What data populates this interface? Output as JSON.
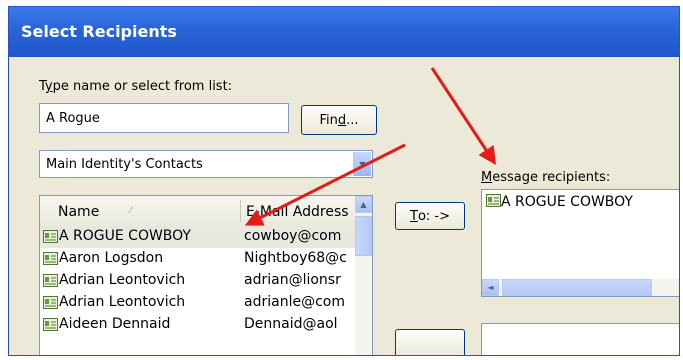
{
  "window": {
    "title": "Select Recipients"
  },
  "search": {
    "label_prefix": "T",
    "label_underlined": "y",
    "label_suffix": "pe name or select from list:",
    "value": "A Rogue"
  },
  "find_button": {
    "label_prefix": "Fin",
    "label_underlined": "d",
    "label_suffix": "..."
  },
  "address_book": {
    "selected": "Main Identity's Contacts"
  },
  "contacts": {
    "headers": {
      "name": "Name",
      "email": "E-Mail Address"
    },
    "rows": [
      {
        "name": "A ROGUE COWBOY",
        "email": "cowboy@com",
        "selected": true
      },
      {
        "name": "Aaron Logsdon",
        "email": "Nightboy68@c"
      },
      {
        "name": "Adrian Leontovich",
        "email": "adrian@lionsr"
      },
      {
        "name": "Adrian Leontovich",
        "email": "adrianle@com"
      },
      {
        "name": "Aideen Dennaid",
        "email": "Dennaid@aol"
      }
    ]
  },
  "to_button": {
    "label_underlined": "T",
    "label_suffix": "o: ->"
  },
  "recipients": {
    "label_underlined": "M",
    "label_suffix": "essage recipients:",
    "items": [
      "A ROGUE COWBOY"
    ]
  },
  "colors": {
    "titlebar": "#2a63d9",
    "dialog_bg": "#ece9d8",
    "arrow": "#e21b1b",
    "border": "#7f9db9"
  },
  "icons": [
    "contact-card-icon",
    "sort-arrow-icon",
    "scroll-up-icon",
    "scroll-left-icon",
    "dropdown-arrow-icon"
  ]
}
